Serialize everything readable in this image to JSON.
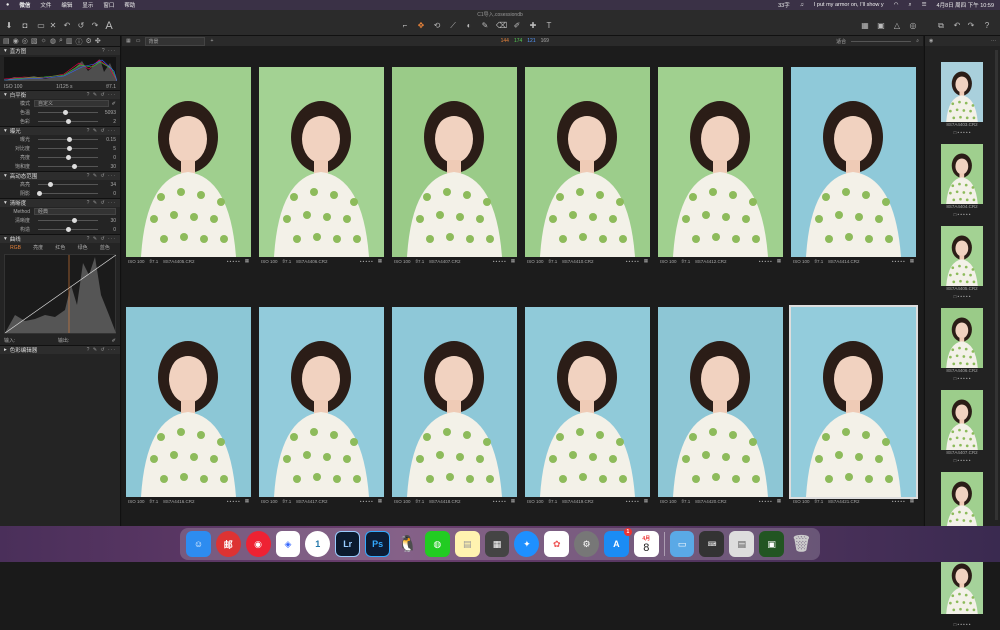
{
  "menubar": {
    "apple": "",
    "app": "微信",
    "items": [
      "文件",
      "编辑",
      "显示",
      "窗口",
      "帮助"
    ],
    "status_text": "33字",
    "song": "I put my armor on, I'll show y",
    "datetime": "4月8日 周四 下午 10:59"
  },
  "window": {
    "title": "C1导入.cosessiondb"
  },
  "left": {
    "histogram_title": "直方图",
    "iso": "ISO 100",
    "shutter": "1/125 s",
    "aperture": "f/7.1",
    "wb": {
      "title": "白平衡",
      "mode_label": "模式",
      "mode_value": "自定义",
      "temp_label": "色温",
      "temp_value": "5093",
      "tint_label": "色彩",
      "tint_value": "2",
      "temp_pos": 0.45,
      "tint_pos": 0.5
    },
    "exposure": {
      "title": "曝光",
      "rows": [
        {
          "label": "曝光",
          "value": "0.15",
          "pos": 0.52
        },
        {
          "label": "对比度",
          "value": "5",
          "pos": 0.52
        },
        {
          "label": "亮度",
          "value": "0",
          "pos": 0.5
        },
        {
          "label": "饱和度",
          "value": "30",
          "pos": 0.6
        }
      ]
    },
    "hdr": {
      "title": "高动态范围",
      "rows": [
        {
          "label": "高亮",
          "value": "34",
          "pos": 0.2
        },
        {
          "label": "阴影",
          "value": "0",
          "pos": 0.02
        }
      ]
    },
    "clarity": {
      "title": "清晰度",
      "method_label": "Method",
      "method_value": "经典",
      "rows": [
        {
          "label": "清晰度",
          "value": "30",
          "pos": 0.6
        },
        {
          "label": "构造",
          "value": "0",
          "pos": 0.5
        }
      ]
    },
    "curve": {
      "title": "曲线",
      "tabs": [
        "RGB",
        "亮度",
        "红色",
        "绿色",
        "蓝色"
      ],
      "input_label": "输入:",
      "output_label": "输出:"
    },
    "color_editor": {
      "title": "色彩编辑器"
    }
  },
  "viewer": {
    "preset": "背景",
    "counts": [
      "144",
      "174",
      "121",
      "169"
    ],
    "fit": "适合",
    "photos": [
      {
        "iso": "ISO 100",
        "ap": "f/7.1",
        "file": "8S7A4405.CR2",
        "bg": "#9fcf8e"
      },
      {
        "iso": "ISO 100",
        "ap": "f/7.1",
        "file": "8S7A4406.CR2",
        "bg": "#a3d293"
      },
      {
        "iso": "ISO 100",
        "ap": "f/7.1",
        "file": "8S7A4407.CR2",
        "bg": "#9acb88"
      },
      {
        "iso": "ISO 100",
        "ap": "f/7.1",
        "file": "8S7A4410.CR2",
        "bg": "#9ccd8b"
      },
      {
        "iso": "ISO 100",
        "ap": "f/7.1",
        "file": "8S7A4412.CR2",
        "bg": "#a0d08f"
      },
      {
        "iso": "ISO 100",
        "ap": "f/7.1",
        "file": "8S7A4414.CR2",
        "bg": "#8fc9d9"
      },
      {
        "iso": "ISO 100",
        "ap": "f/7.1",
        "file": "8S7A4416.CR2",
        "bg": "#8cc7d6"
      },
      {
        "iso": "ISO 100",
        "ap": "f/7.1",
        "file": "8S7A4417.CR2",
        "bg": "#92cbdb"
      },
      {
        "iso": "ISO 100",
        "ap": "f/7.1",
        "file": "8S7A4418.CR2",
        "bg": "#8ec8d8"
      },
      {
        "iso": "ISO 100",
        "ap": "f/7.1",
        "file": "8S7A4419.CR2",
        "bg": "#90cad9"
      },
      {
        "iso": "ISO 100",
        "ap": "f/7.1",
        "file": "8S7A4420.CR2",
        "bg": "#8dc6d5"
      },
      {
        "iso": "ISO 100",
        "ap": "f/7.1",
        "file": "8S7A4421.CR2",
        "bg": "#93ccdc"
      }
    ]
  },
  "filmstrip": [
    {
      "file": "8S7A4403.CR2",
      "bg": "#a9d0dc"
    },
    {
      "file": "8S7A4404.CR2",
      "bg": "#9fcf8e"
    },
    {
      "file": "8S7A4405.CR2",
      "bg": "#a3d293"
    },
    {
      "file": "8S7A4406.CR2",
      "bg": "#9acb88"
    },
    {
      "file": "8S7A4407.CR2",
      "bg": "#9ccd8b"
    },
    {
      "file": "8S7A4408.CR2",
      "bg": "#a0d08f"
    },
    {
      "file": "",
      "bg": "#a5d29a"
    }
  ],
  "dock": {
    "calendar_month": "4月",
    "calendar_day": "8",
    "appstore_badge": "1"
  }
}
